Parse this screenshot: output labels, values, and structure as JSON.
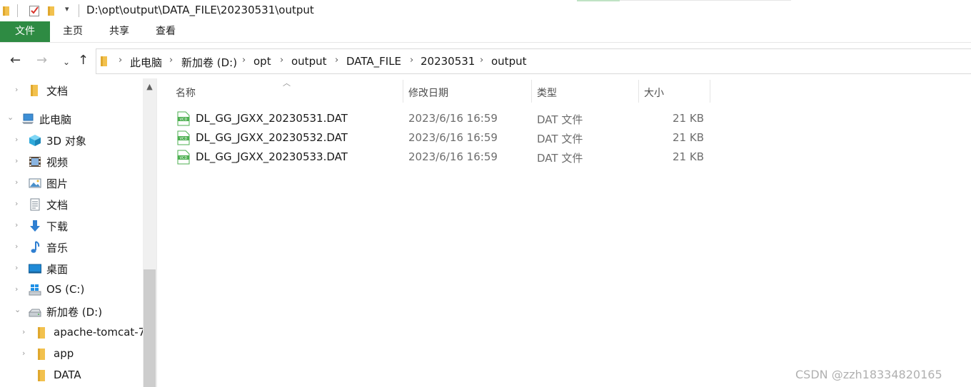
{
  "window": {
    "path": "D:\\opt\\output\\DATA_FILE\\20230531\\output"
  },
  "ribbon": {
    "tabs": [
      "文件",
      "主页",
      "共享",
      "查看"
    ]
  },
  "address": {
    "crumbs": [
      "此电脑",
      "新加卷 (D:)",
      "opt",
      "output",
      "DATA_FILE",
      "20230531",
      "output"
    ]
  },
  "sidebar": {
    "items": [
      {
        "label": "文档",
        "icon": "folder-icon"
      },
      {
        "label": "此电脑",
        "icon": "computer-icon"
      },
      {
        "label": "3D 对象",
        "icon": "3d-objects-icon"
      },
      {
        "label": "视频",
        "icon": "video-icon"
      },
      {
        "label": "图片",
        "icon": "pictures-icon"
      },
      {
        "label": "文档",
        "icon": "documents-icon"
      },
      {
        "label": "下载",
        "icon": "download-icon"
      },
      {
        "label": "音乐",
        "icon": "music-icon"
      },
      {
        "label": "桌面",
        "icon": "desktop-icon"
      },
      {
        "label": "OS (C:)",
        "icon": "windows-drive-icon"
      },
      {
        "label": "新加卷 (D:)",
        "icon": "drive-icon"
      },
      {
        "label": "apache-tomcat-7",
        "icon": "folder-icon"
      },
      {
        "label": "app",
        "icon": "folder-icon"
      },
      {
        "label": "DATA",
        "icon": "folder-icon"
      }
    ]
  },
  "table": {
    "columns": [
      "名称",
      "修改日期",
      "类型",
      "大小"
    ],
    "rows": [
      {
        "name": "DL_GG_JGXX_20230531.DAT",
        "date": "2023/6/16 16:59",
        "type": "DAT 文件",
        "size": "21 KB"
      },
      {
        "name": "DL_GG_JGXX_20230532.DAT",
        "date": "2023/6/16 16:59",
        "type": "DAT 文件",
        "size": "21 KB"
      },
      {
        "name": "DL_GG_JGXX_20230533.DAT",
        "date": "2023/6/16 16:59",
        "type": "DAT 文件",
        "size": "21 KB"
      }
    ]
  },
  "file_icon_text": "VCD",
  "watermark": "CSDN @zzh18334820165",
  "colors": {
    "file_tab": "#2e8b43",
    "folder": "#f2c14e",
    "file_icon": "#4caf50"
  }
}
